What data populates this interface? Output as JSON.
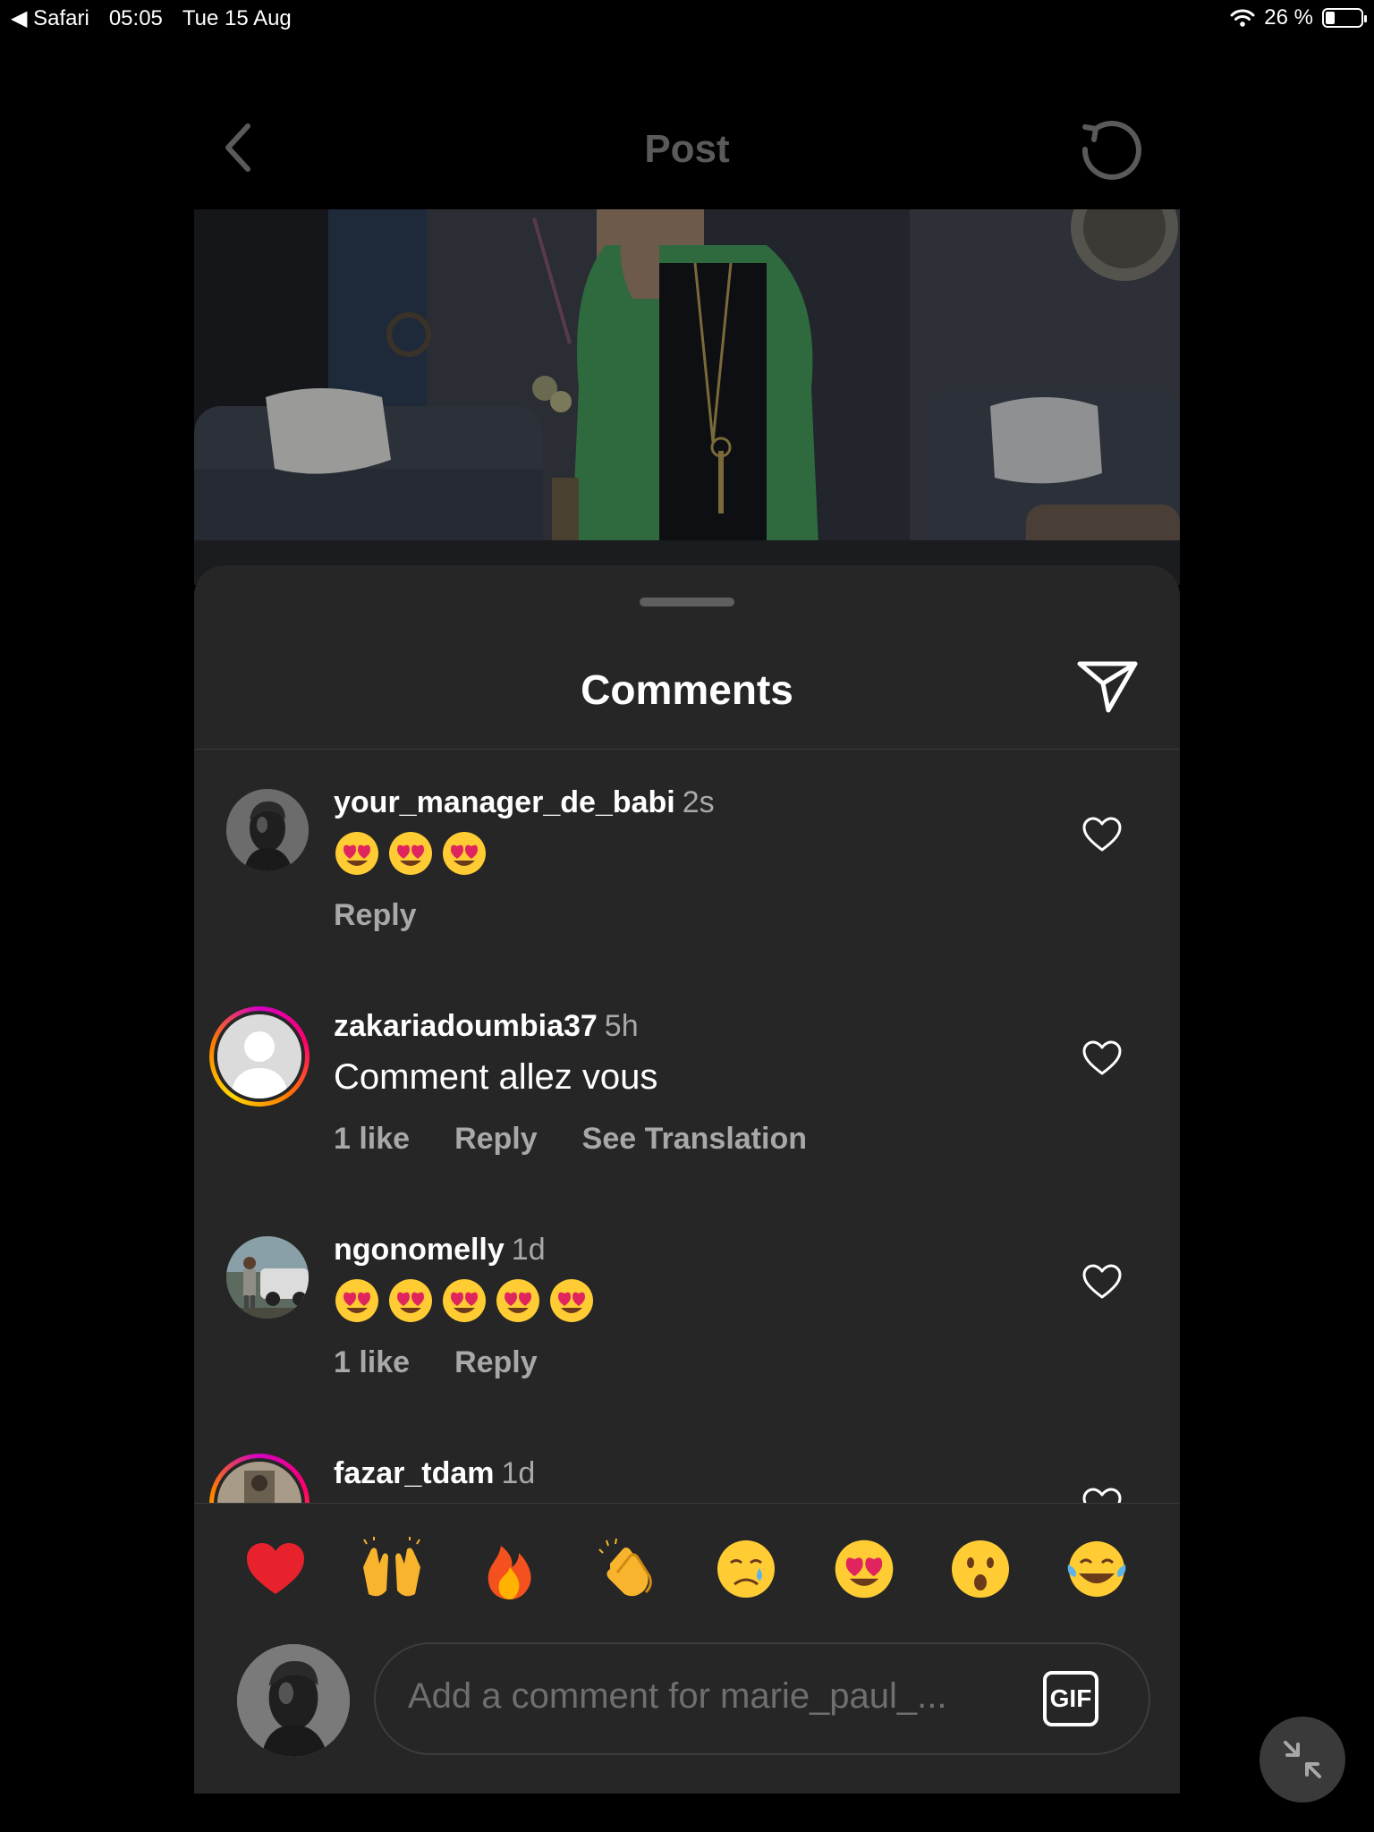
{
  "status_bar": {
    "back_app": "◀ Safari",
    "time": "05:05",
    "date": "Tue 15 Aug",
    "battery_text": "26 %",
    "battery_level": 0.26
  },
  "header": {
    "title": "Post",
    "back_icon": "chevron-left-icon",
    "refresh_icon": "refresh-icon"
  },
  "sheet": {
    "title": "Comments",
    "share_icon": "paper-plane-icon"
  },
  "comments": [
    {
      "username": "your_manager_de_babi",
      "time": "2s",
      "emojis": [
        "😍",
        "😍",
        "😍"
      ],
      "actions": [
        "Reply"
      ]
    },
    {
      "username": "zakariadoumbia37",
      "time": "5h",
      "text": "Comment allez vous",
      "actions": [
        "1 like",
        "Reply",
        "See Translation"
      ]
    },
    {
      "username": "ngonomelly",
      "time": "1d",
      "emojis": [
        "😍",
        "😍",
        "😍",
        "😍",
        "😍"
      ],
      "actions": [
        "1 like",
        "Reply"
      ]
    },
    {
      "username": "fazar_tdam",
      "time": "1d"
    }
  ],
  "reactions": [
    "❤️",
    "🙌",
    "🔥",
    "👏",
    "😢",
    "😍",
    "😮",
    "😂"
  ],
  "composer": {
    "placeholder": "Add a comment for marie_paul_...",
    "gif_label": "GIF"
  },
  "colors": {
    "sheet_bg": "#262626",
    "muted": "#a8a8a8",
    "background": "#000000"
  }
}
